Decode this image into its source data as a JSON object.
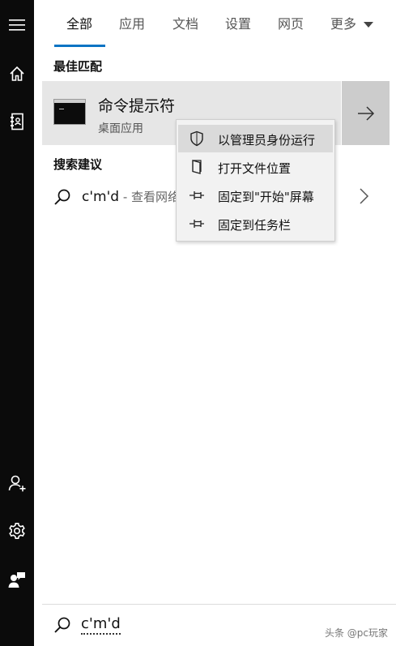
{
  "tabs": [
    {
      "label": "全部"
    },
    {
      "label": "应用"
    },
    {
      "label": "文档"
    },
    {
      "label": "设置"
    },
    {
      "label": "网页"
    },
    {
      "label": "更多"
    }
  ],
  "sections": {
    "best_match": "最佳匹配",
    "suggestions": "搜索建议"
  },
  "best_match": {
    "title": "命令提示符",
    "subtitle": "桌面应用"
  },
  "suggestion": {
    "query": "c'm'd",
    "suffix": " - 查看网络"
  },
  "context_menu": [
    {
      "label": "以管理员身份运行",
      "icon": "shield-icon"
    },
    {
      "label": "打开文件位置",
      "icon": "folder-icon"
    },
    {
      "label": "固定到\"开始\"屏幕",
      "icon": "pin-icon"
    },
    {
      "label": "固定到任务栏",
      "icon": "pin-icon"
    }
  ],
  "search": {
    "value": "c'm'd"
  },
  "watermark": "头条 @pc玩家",
  "colors": {
    "accent": "#0a74c4",
    "rail": "#0b0b0b",
    "selected_row": "#e6e6e6"
  }
}
